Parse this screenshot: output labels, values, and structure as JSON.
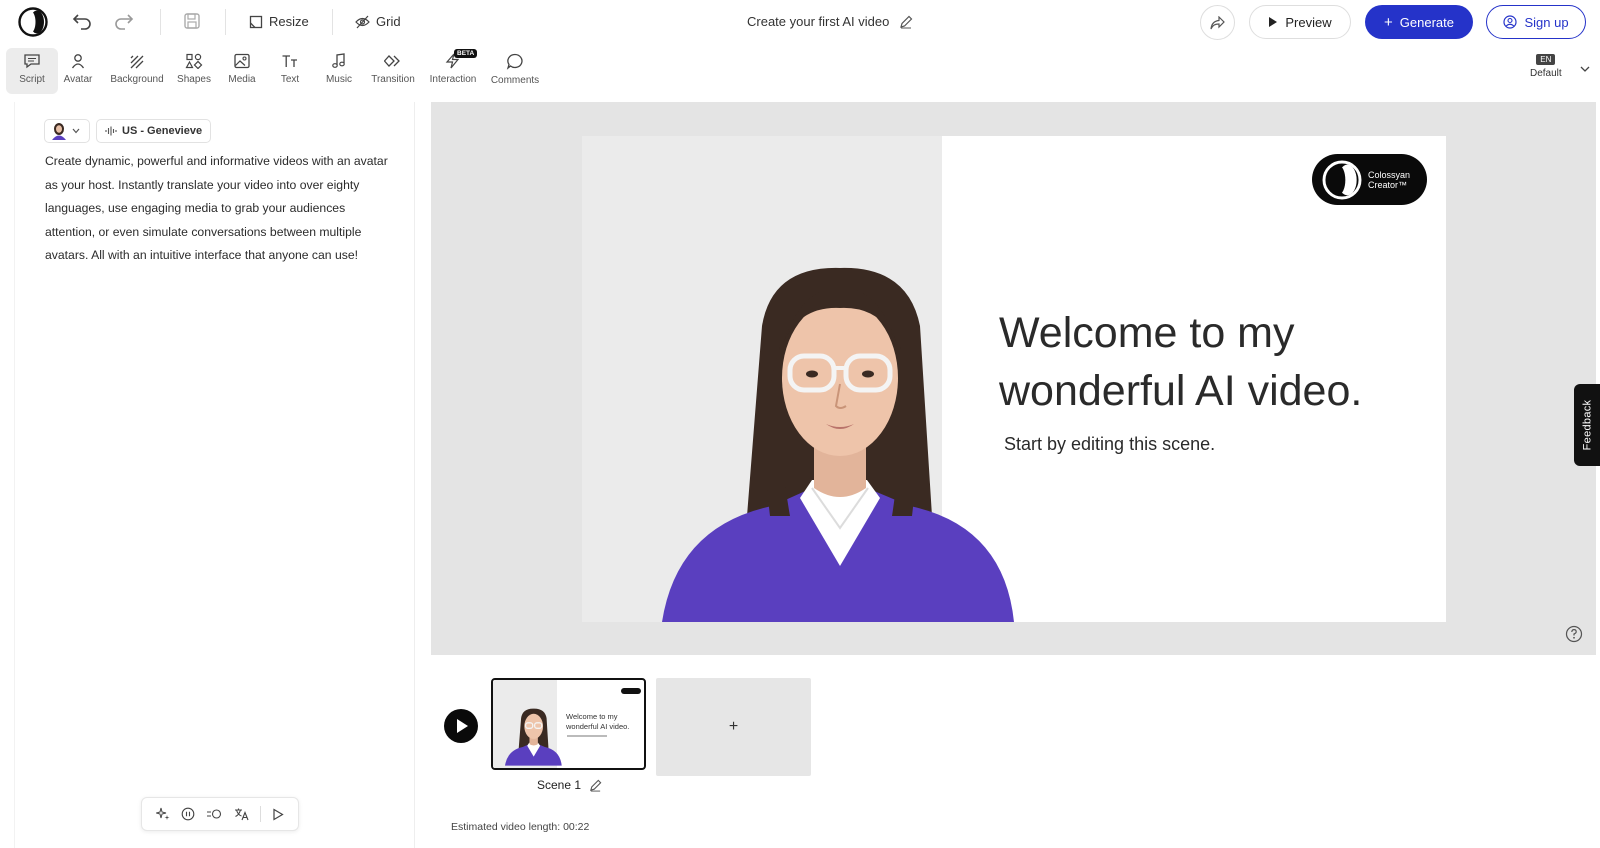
{
  "topbar": {
    "resize_label": "Resize",
    "grid_label": "Grid",
    "project_title": "Create your first AI video",
    "preview_label": "Preview",
    "generate_label": "Generate",
    "signup_label": "Sign up"
  },
  "toolbar": {
    "items": [
      {
        "label": "Script",
        "icon": "script-icon"
      },
      {
        "label": "Avatar",
        "icon": "avatar-icon"
      },
      {
        "label": "Background",
        "icon": "background-icon"
      },
      {
        "label": "Shapes",
        "icon": "shapes-icon"
      },
      {
        "label": "Media",
        "icon": "media-icon"
      },
      {
        "label": "Text",
        "icon": "text-icon"
      },
      {
        "label": "Music",
        "icon": "music-icon"
      },
      {
        "label": "Transition",
        "icon": "transition-icon"
      },
      {
        "label": "Interaction",
        "icon": "interaction-icon",
        "badge": "BETA"
      },
      {
        "label": "Comments",
        "icon": "comments-icon"
      }
    ],
    "language": {
      "code": "EN",
      "label": "Default"
    }
  },
  "script": {
    "voice_label": "US - Genevieve",
    "text": "Create dynamic, powerful and informative videos with an avatar as your host. Instantly translate your video into over eighty languages, use engaging media to grab your audiences attention, or even simulate conversations between multiple avatars. All with an intuitive interface that anyone can use!"
  },
  "slide": {
    "logo_line1": "Colossyan",
    "logo_line2": "Creator™",
    "heading_line1": "Welcome to my",
    "heading_line2": "wonderful AI video.",
    "subheading": "Start by editing this scene.",
    "colors": {
      "sweater": "#5a3fbf",
      "logo_bg": "#0a0a0a"
    }
  },
  "timeline": {
    "thumb_heading_line1": "Welcome to my",
    "thumb_heading_line2": "wonderful AI video.",
    "scene_label": "Scene 1",
    "add_label": "+",
    "estimate": "Estimated video length: 00:22"
  },
  "feedback_label": "Feedback",
  "colors": {
    "accent": "#2533c9",
    "text": "#1f1f1f"
  }
}
